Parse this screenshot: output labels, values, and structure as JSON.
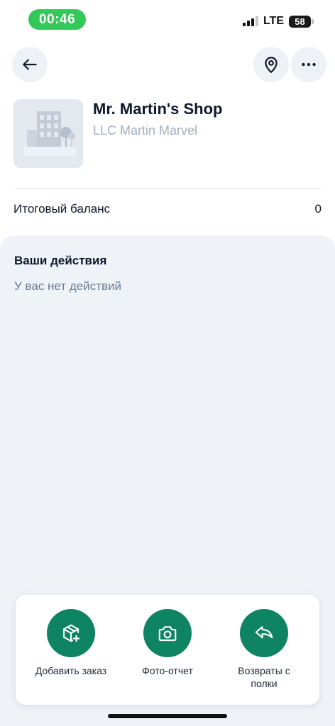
{
  "status_bar": {
    "time": "00:46",
    "network": "LTE",
    "battery_percent": "58",
    "battery_level": 0.58
  },
  "header": {
    "back_icon": "arrow-left-icon",
    "location_icon": "map-pin-icon",
    "more_icon": "more-horizontal-icon"
  },
  "shop": {
    "name": "Mr. Martin's Shop",
    "company": "LLC Martin Marvel",
    "thumbnail_icon": "building-placeholder-icon"
  },
  "balance": {
    "label": "Итоговый баланс",
    "value": "0"
  },
  "actions_panel": {
    "title": "Ваши действия",
    "empty_text": "У вас нет действий"
  },
  "bottom_actions": [
    {
      "label": "Добавить заказ",
      "icon": "package-plus-icon"
    },
    {
      "label": "Фото-отчет",
      "icon": "camera-icon"
    },
    {
      "label": "Возвраты с полки",
      "icon": "reply-icon"
    }
  ],
  "colors": {
    "accent": "#0e8463",
    "status_pill": "#34c759",
    "panel_bg": "#eff3f8",
    "muted_text": "#a3aebf"
  }
}
